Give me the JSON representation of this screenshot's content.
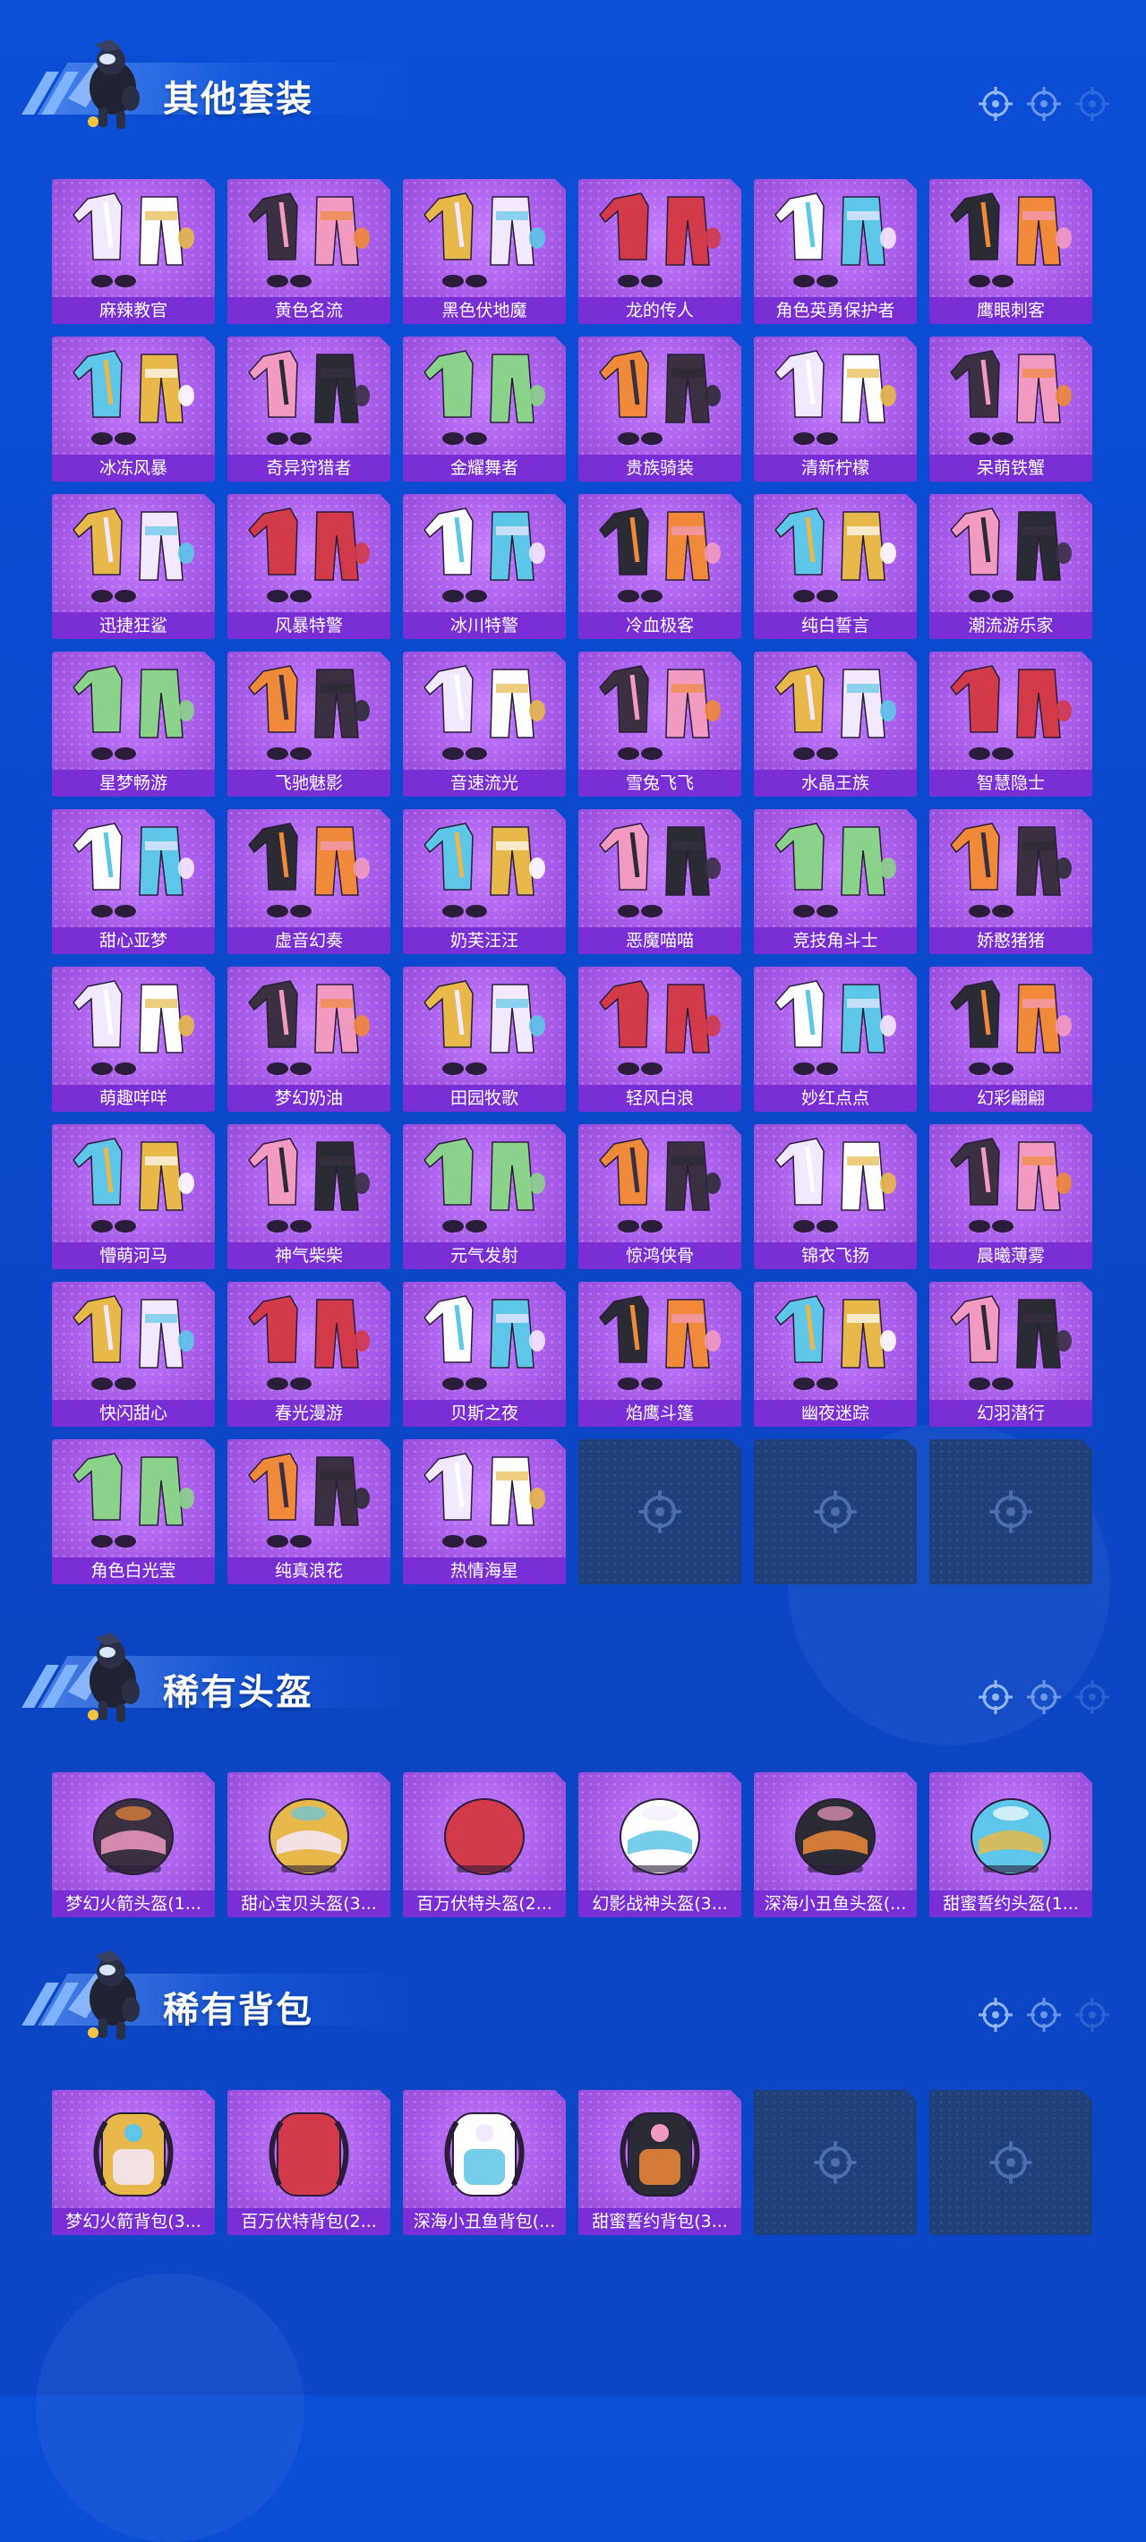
{
  "colors": {
    "background": "#0b4fd6",
    "card_purple": "#a75be8",
    "label_purple": "#7a2fd6",
    "empty_slot": "#1d3f7a"
  },
  "sections": [
    {
      "title": "其他套装",
      "item_type": "outfit",
      "items": [
        "麻辣教官",
        "黄色名流",
        "黑色伏地魔",
        "龙的传人",
        "角色英勇保护者",
        "鹰眼刺客",
        "冰冻风暴",
        "奇异狩猎者",
        "金耀舞者",
        "贵族骑装",
        "清新柠檬",
        "呆萌铁蟹",
        "迅捷狂鲨",
        "风暴特警",
        "冰川特警",
        "冷血极客",
        "纯白誓言",
        "潮流游乐家",
        "星梦畅游",
        "飞驰魅影",
        "音速流光",
        "雪兔飞飞",
        "水晶王族",
        "智慧隐士",
        "甜心亚梦",
        "虚音幻奏",
        "奶芙汪汪",
        "恶魔喵喵",
        "竞技角斗士",
        "娇憨猪猪",
        "萌趣咩咩",
        "梦幻奶油",
        "田园牧歌",
        "轻风白浪",
        "妙红点点",
        "幻彩翩翩",
        "懵萌河马",
        "神气柴柴",
        "元气发射",
        "惊鸿侠骨",
        "锦衣飞扬",
        "晨曦薄雾",
        "快闪甜心",
        "春光漫游",
        "贝斯之夜",
        "焰鹰斗篷",
        "幽夜迷踪",
        "幻羽潜行",
        "角色白光莹",
        "纯真浪花",
        "热情海星"
      ],
      "empty_slots": 3
    },
    {
      "title": "稀有头盔",
      "item_type": "helmet",
      "items": [
        "梦幻火箭头盔(1...",
        "甜心宝贝头盔(3...",
        "百万伏特头盔(2...",
        "幻影战神头盔(3...",
        "深海小丑鱼头盔(...",
        "甜蜜誓约头盔(1..."
      ],
      "empty_slots": 0
    },
    {
      "title": "稀有背包",
      "item_type": "backpack",
      "items": [
        "梦幻火箭背包(3...",
        "百万伏特背包(2...",
        "深海小丑鱼背包(...",
        "甜蜜誓约背包(3..."
      ],
      "empty_slots": 2
    }
  ]
}
